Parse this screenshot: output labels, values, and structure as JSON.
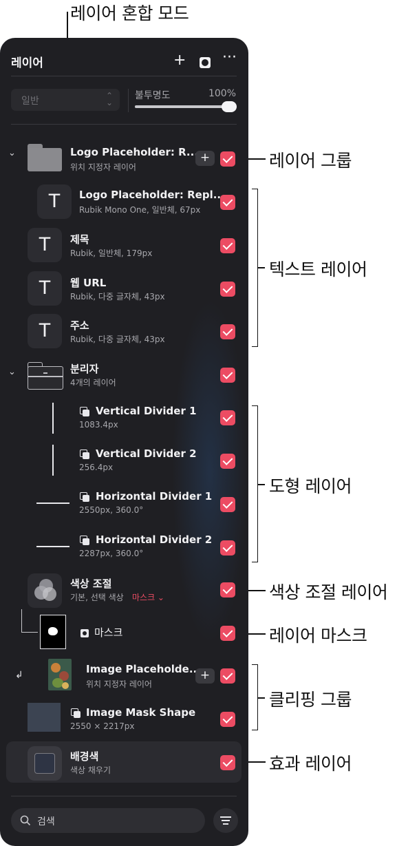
{
  "callouts": {
    "blend_mode": "레이어 혼합 모드",
    "layer_group": "레이어 그룹",
    "text_layers": "텍스트 레이어",
    "shape_layers": "도형 레이어",
    "color_adjust_layer": "색상 조절 레이어",
    "layer_mask": "레이어 마스크",
    "clipping_group": "클리핑 그룹",
    "effect_layer": "효과 레이어"
  },
  "panel": {
    "title": "레이어",
    "add_icon": "plus-icon",
    "mask_icon": "mask-icon",
    "more_icon": "ellipsis-icon"
  },
  "blend": {
    "value": "일반",
    "chevron": "⌃⌄"
  },
  "opacity": {
    "label": "불투명도",
    "value": "100%",
    "level": 1.0
  },
  "layers": [
    {
      "name": "Logo Placeholder: R...",
      "sub": "위치 지정자 레이어",
      "kind": "group",
      "checked": true
    },
    {
      "name": "Logo Placeholder: Repl...",
      "sub": "Rubik Mono One, 일반체, 67px",
      "kind": "text",
      "checked": true
    },
    {
      "name": "제목",
      "sub": "Rubik, 일반체, 179px",
      "kind": "text",
      "checked": true
    },
    {
      "name": "웹 URL",
      "sub": "Rubik, 다중 글자체, 43px",
      "kind": "text",
      "checked": true
    },
    {
      "name": "주소",
      "sub": "Rubik, 다중 글자체, 43px",
      "kind": "text",
      "checked": true
    },
    {
      "name": "분리자",
      "sub": "4개의 레이어",
      "kind": "group",
      "checked": true
    },
    {
      "name": "Vertical Divider 1",
      "sub": "1083.4px",
      "kind": "shape",
      "checked": true
    },
    {
      "name": "Vertical Divider 2",
      "sub": "256.4px",
      "kind": "shape",
      "checked": true
    },
    {
      "name": "Horizontal Divider 1",
      "sub": "2550px, 360.0°",
      "kind": "shape",
      "checked": true
    },
    {
      "name": "Horizontal Divider 2",
      "sub": "2287px, 360.0°",
      "kind": "shape",
      "checked": true
    },
    {
      "name": "색상 조절",
      "sub": "기본, 선택 색상",
      "mask_label": "마스크 ⌄",
      "kind": "adjustment",
      "checked": true
    },
    {
      "name": "마스크",
      "kind": "mask",
      "checked": true
    },
    {
      "name": "Image Placeholde...",
      "sub": "위치 지정자 레이어",
      "kind": "image",
      "checked": true
    },
    {
      "name": "Image Mask Shape",
      "sub": "2550 × 2217px",
      "kind": "shape",
      "checked": true
    },
    {
      "name": "배경색",
      "sub": "색상 채우기",
      "kind": "fill",
      "checked": true
    }
  ],
  "glyphs": {
    "text_thumb": "T",
    "plus": "+",
    "disclosure": "⌄",
    "clip_arrow": "↲"
  },
  "search": {
    "placeholder": "검색"
  },
  "colors": {
    "panel_bg": "#1f1f23",
    "checkbox": "#ec4c63",
    "accent_text": "#ec4c63"
  }
}
